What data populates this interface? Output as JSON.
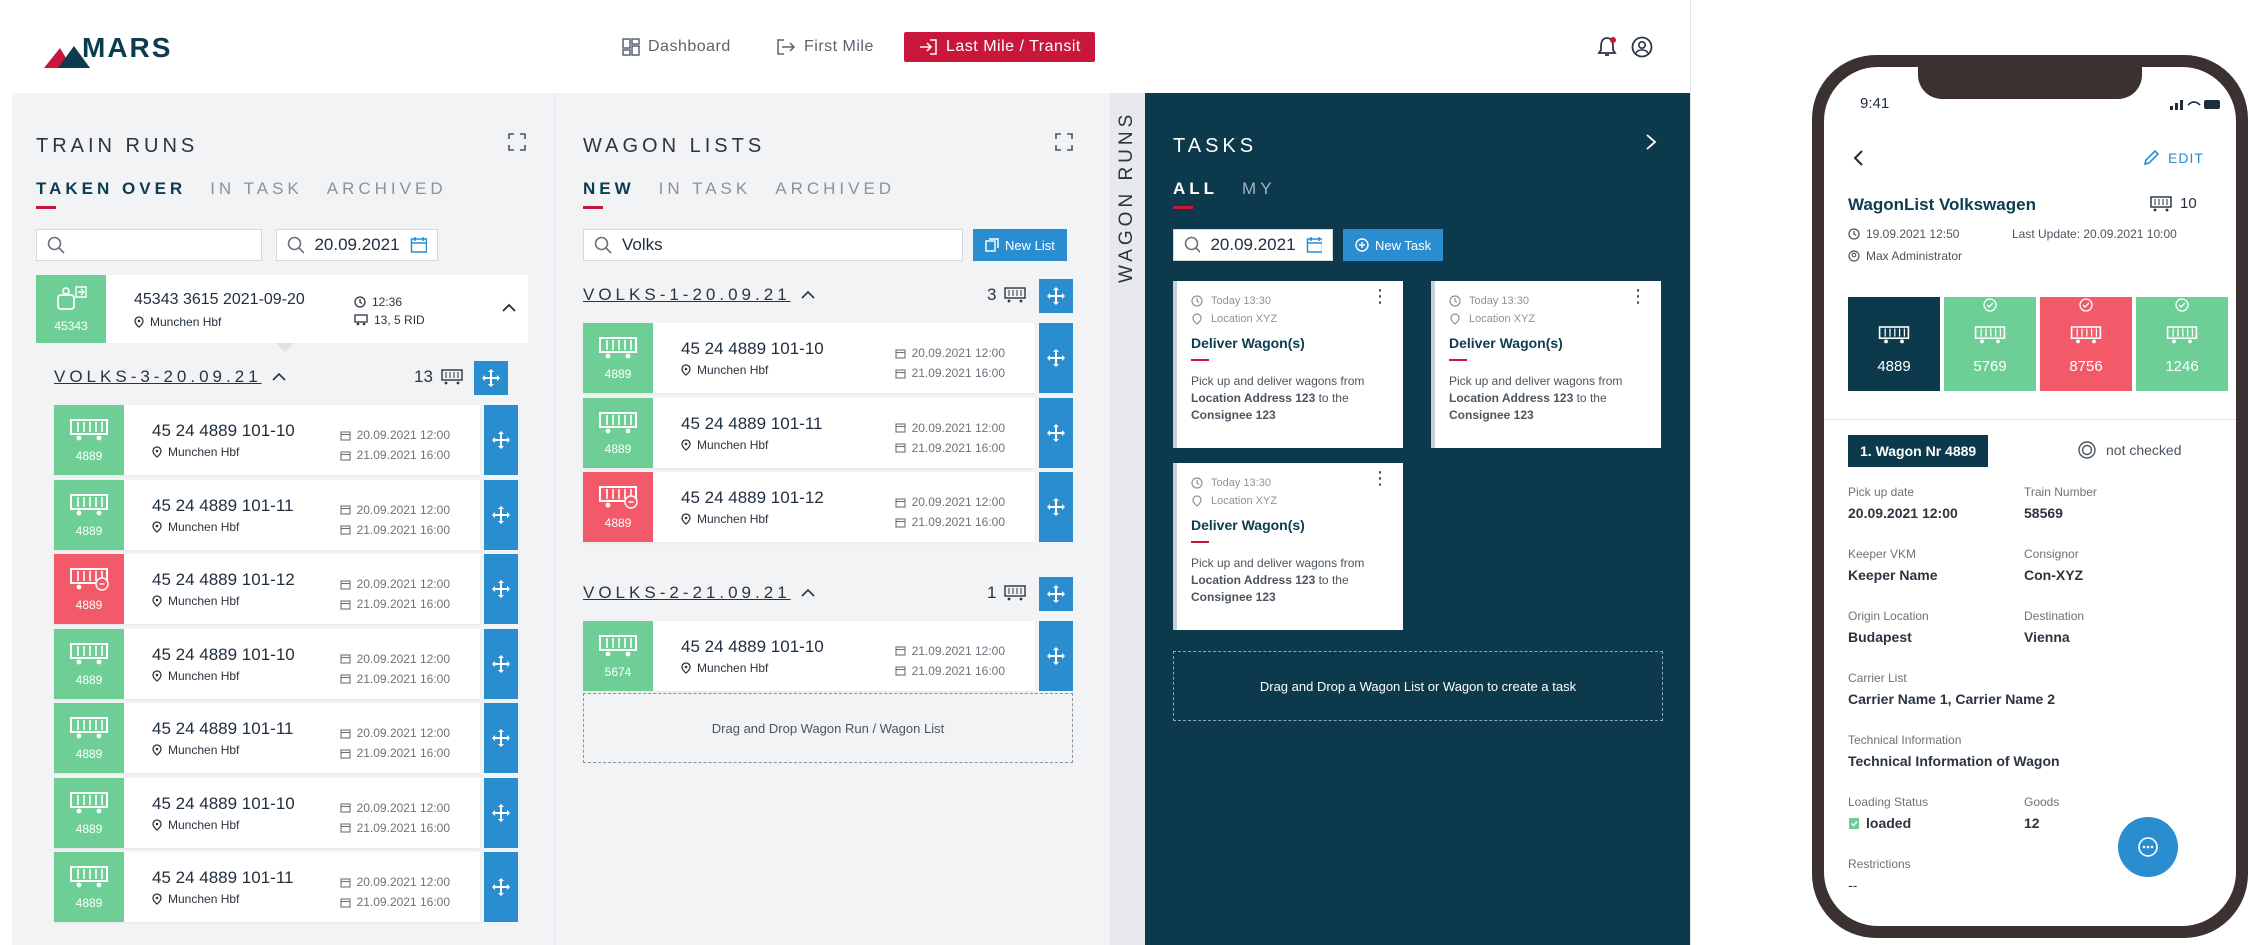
{
  "app": {
    "logo": "MARS"
  },
  "nav": {
    "dashboard": "Dashboard",
    "first_mile": "First Mile",
    "last_mile": "Last Mile / Transit"
  },
  "train_runs": {
    "title": "TRAIN RUNS",
    "tabs": [
      "TAKEN OVER",
      "IN TASK",
      "ARCHIVED"
    ],
    "search_value": "",
    "date_value": "20.09.2021",
    "train": {
      "id": "45343 3615 2021-09-20",
      "badge": "45343",
      "time": "12:36",
      "rid": "13, 5 RID",
      "location": "Munchen Hbf"
    },
    "group": {
      "name": "VOLKS-3-20.09.21",
      "count": "13"
    },
    "wagons": [
      {
        "num": "45 24 4889 101-10",
        "badge": "4889",
        "status": "green",
        "loc": "Munchen Hbf",
        "d1": "20.09.2021 12:00",
        "d2": "21.09.2021 16:00"
      },
      {
        "num": "45 24 4889 101-11",
        "badge": "4889",
        "status": "green",
        "loc": "Munchen Hbf",
        "d1": "20.09.2021 12:00",
        "d2": "21.09.2021 16:00"
      },
      {
        "num": "45 24 4889 101-12",
        "badge": "4889",
        "status": "red",
        "loc": "Munchen Hbf",
        "d1": "20.09.2021 12:00",
        "d2": "21.09.2021 16:00"
      },
      {
        "num": "45 24 4889 101-10",
        "badge": "4889",
        "status": "green",
        "loc": "Munchen Hbf",
        "d1": "20.09.2021 12:00",
        "d2": "21.09.2021 16:00"
      },
      {
        "num": "45 24 4889 101-11",
        "badge": "4889",
        "status": "green",
        "loc": "Munchen Hbf",
        "d1": "20.09.2021 12:00",
        "d2": "21.09.2021 16:00"
      },
      {
        "num": "45 24 4889 101-10",
        "badge": "4889",
        "status": "green",
        "loc": "Munchen Hbf",
        "d1": "20.09.2021 12:00",
        "d2": "21.09.2021 16:00"
      },
      {
        "num": "45 24 4889 101-11",
        "badge": "4889",
        "status": "green",
        "loc": "Munchen Hbf",
        "d1": "20.09.2021 12:00",
        "d2": "21.09.2021 16:00"
      }
    ]
  },
  "wagon_lists": {
    "title": "WAGON LISTS",
    "tabs": [
      "NEW",
      "IN TASK",
      "ARCHIVED"
    ],
    "search_value": "Volks",
    "new_list": "New List",
    "groups": [
      {
        "name": "VOLKS-1-20.09.21",
        "count": "3",
        "wagons": [
          {
            "num": "45 24 4889 101-10",
            "badge": "4889",
            "status": "green",
            "loc": "Munchen Hbf",
            "d1": "20.09.2021 12:00",
            "d2": "21.09.2021 16:00"
          },
          {
            "num": "45 24 4889 101-11",
            "badge": "4889",
            "status": "green",
            "loc": "Munchen Hbf",
            "d1": "20.09.2021 12:00",
            "d2": "21.09.2021 16:00"
          },
          {
            "num": "45 24 4889 101-12",
            "badge": "4889",
            "status": "red",
            "loc": "Munchen Hbf",
            "d1": "20.09.2021 12:00",
            "d2": "21.09.2021 16:00"
          }
        ]
      },
      {
        "name": "VOLKS-2-21.09.21",
        "count": "1",
        "wagons": [
          {
            "num": "45 24 4889 101-10",
            "badge": "5674",
            "status": "green",
            "loc": "Munchen Hbf",
            "d1": "21.09.2021 12:00",
            "d2": "21.09.2021 16:00"
          }
        ]
      }
    ],
    "dropzone": "Drag and Drop Wagon Run / Wagon List"
  },
  "wagon_runs": {
    "title": "WAGON RUNS"
  },
  "tasks": {
    "title": "TASKS",
    "tabs": [
      "ALL",
      "MY"
    ],
    "date_value": "20.09.2021",
    "new_task": "New Task",
    "items": [
      {
        "time": "Today 13:30",
        "location": "Location XYZ",
        "title": "Deliver Wagon(s)",
        "desc_pre": "Pick up and deliver wagons from ",
        "desc_addr": "Location Address 123",
        "desc_mid": " to the ",
        "desc_cons": "Consignee 123"
      },
      {
        "time": "Today 13:30",
        "location": "Location XYZ",
        "title": "Deliver Wagon(s)",
        "desc_pre": "Pick up and deliver wagons from ",
        "desc_addr": "Location Address 123",
        "desc_mid": " to the ",
        "desc_cons": "Consignee 123"
      },
      {
        "time": "Today 13:30",
        "location": "Location XYZ",
        "title": "Deliver Wagon(s)",
        "desc_pre": "Pick up and deliver wagons from ",
        "desc_addr": "Location Address 123",
        "desc_mid": " to the ",
        "desc_cons": "Consignee 123"
      }
    ],
    "dropzone": "Drag and Drop a Wagon List or Wagon to create a task"
  },
  "phone": {
    "time": "9:41",
    "edit": "EDIT",
    "list_title": "WagonList Volkswagen",
    "wagon_count": "10",
    "created": "19.09.2021 12:50",
    "last_update": "Last Update: 20.09.2021 10:00",
    "user": "Max Administrator",
    "tiles": [
      {
        "value": "4889",
        "color": "#0c3a4c"
      },
      {
        "value": "5769",
        "color": "#6dcf96"
      },
      {
        "value": "8756",
        "color": "#f25a6a"
      },
      {
        "value": "1246",
        "color": "#6dcf96"
      }
    ],
    "wagon_badge": "1. Wagon Nr 4889",
    "check_status": "not checked",
    "fields": {
      "pickup_label": "Pick up date",
      "pickup_value": "20.09.2021  12:00",
      "train_label": "Train Number",
      "train_value": "58569",
      "keeper_label": "Keeper VKM",
      "keeper_value": "Keeper Name",
      "consignor_label": "Consignor",
      "consignor_value": "Con-XYZ",
      "origin_label": "Origin Location",
      "origin_value": "Budapest",
      "dest_label": "Destination",
      "dest_value": "Vienna",
      "carrier_label": "Carrier List",
      "carrier_value": "Carrier Name 1, Carrier Name 2",
      "tech_label": "Technical Information",
      "tech_value": "Technical Information of Wagon",
      "loading_label": "Loading Status",
      "loading_value": "loaded",
      "goods_label": "Goods",
      "goods_value": "12",
      "restrictions_label": "Restrictions",
      "restrictions_value": "--"
    }
  },
  "colors": {
    "brand_red": "#c8173a",
    "navy": "#0c3a4c",
    "blue": "#2a8dd0",
    "green": "#6dcf96",
    "red": "#f25a6a"
  }
}
